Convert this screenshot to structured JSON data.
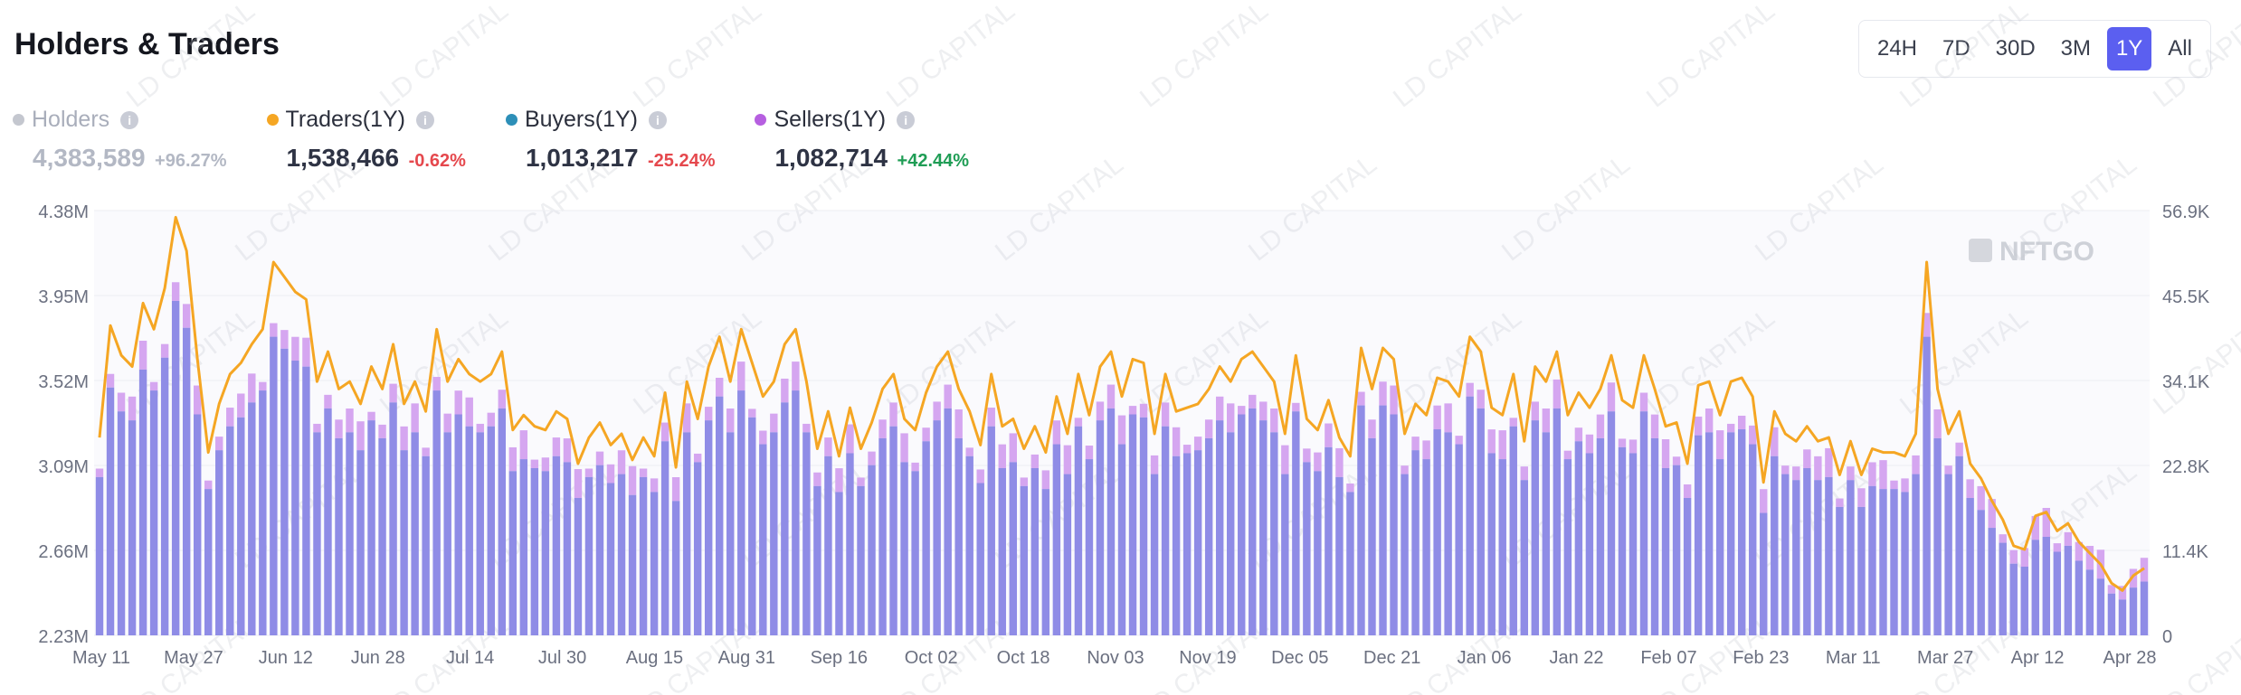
{
  "header": {
    "title": "Holders & Traders"
  },
  "time_range": {
    "options": [
      "24H",
      "7D",
      "30D",
      "3M",
      "1Y",
      "All"
    ],
    "selected": "1Y"
  },
  "legend": [
    {
      "label": "Holders",
      "value": "4,383,589",
      "change": "+96.27%",
      "color": "#c4c7cf",
      "state": "dim"
    },
    {
      "label": "Traders(1Y)",
      "value": "1,538,466",
      "change": "-0.62%",
      "color": "#f5a623",
      "state": "neg"
    },
    {
      "label": "Buyers(1Y)",
      "value": "1,013,217",
      "change": "-25.24%",
      "color": "#2d8fb8",
      "state": "neg"
    },
    {
      "label": "Sellers(1Y)",
      "value": "1,082,714",
      "change": "+42.44%",
      "color": "#b65fe0",
      "state": "pos"
    }
  ],
  "watermarks": {
    "brand": "NFTGO",
    "overlay": "LD CAPITAL"
  },
  "chart_data": {
    "type": "bar",
    "x_labels": [
      "May 11",
      "May 27",
      "Jun 12",
      "Jun 28",
      "Jul 14",
      "Jul 30",
      "Aug 15",
      "Aug 31",
      "Sep 16",
      "Oct 02",
      "Oct 18",
      "Nov 03",
      "Nov 19",
      "Dec 05",
      "Dec 21",
      "Jan 06",
      "Jan 22",
      "Feb 07",
      "Feb 23",
      "Mar 11",
      "Mar 27",
      "Apr 12",
      "Apr 28"
    ],
    "left_axis": {
      "ticks": [
        "2.23M",
        "2.66M",
        "3.09M",
        "3.52M",
        "3.95M",
        "4.38M"
      ],
      "ylim": [
        2.23,
        4.38
      ],
      "unit": "M"
    },
    "right_axis": {
      "ticks": [
        "0",
        "11.4K",
        "22.8K",
        "34.1K",
        "45.5K",
        "56.9K"
      ],
      "ylim": [
        0,
        56.9
      ],
      "unit": "K"
    },
    "grid": true,
    "colors": {
      "traders": "#f5a623",
      "buyers": "#8f8ce6",
      "sellers": "#d5a6f0",
      "grid": "#eceef2"
    },
    "series": [
      {
        "name": "Traders(1Y)",
        "type": "line",
        "axis": "right",
        "unit": "K",
        "values": [
          26.5,
          41.5,
          37.5,
          36.0,
          44.5,
          41.0,
          46.5,
          56.0,
          51.5,
          37.0,
          24.5,
          31.0,
          35.0,
          36.5,
          39.0,
          41.0,
          50.0,
          48.0,
          46.0,
          45.0,
          34.0,
          38.0,
          33.0,
          34.0,
          31.0,
          36.0,
          33.0,
          39.0,
          31.0,
          34.0,
          30.0,
          41.0,
          34.0,
          37.0,
          35.0,
          34.0,
          35.0,
          38.0,
          27.5,
          29.5,
          28.0,
          27.5,
          30.0,
          29.0,
          23.0,
          26.5,
          28.5,
          25.5,
          27.0,
          23.5,
          26.5,
          24.0,
          32.5,
          22.5,
          34.0,
          29.0,
          36.0,
          40.0,
          34.0,
          41.0,
          36.5,
          32.0,
          34.0,
          39.0,
          41.0,
          34.0,
          25.0,
          30.0,
          24.0,
          30.5,
          25.0,
          28.5,
          33.0,
          35.0,
          29.0,
          27.5,
          32.5,
          36.0,
          38.0,
          33.0,
          30.0,
          25.5,
          35.0,
          28.0,
          29.0,
          25.0,
          28.0,
          24.5,
          32.0,
          27.0,
          35.0,
          29.5,
          36.0,
          38.0,
          32.0,
          37.0,
          36.5,
          27.0,
          35.0,
          30.0,
          30.5,
          31.0,
          33.0,
          36.0,
          34.0,
          37.0,
          38.0,
          36.0,
          34.0,
          27.0,
          37.5,
          29.0,
          27.5,
          31.5,
          26.5,
          24.0,
          38.5,
          33.0,
          38.5,
          37.0,
          27.0,
          31.0,
          29.5,
          34.5,
          34.0,
          32.0,
          40.0,
          38.0,
          30.5,
          29.5,
          35.0,
          26.0,
          36.0,
          34.0,
          38.0,
          29.5,
          32.5,
          30.5,
          33.0,
          37.5,
          31.5,
          30.5,
          37.5,
          33.0,
          28.0,
          28.5,
          23.0,
          33.5,
          34.0,
          29.5,
          34.0,
          34.5,
          32.0,
          20.5,
          30.0,
          27.0,
          26.0,
          28.0,
          26.0,
          26.5,
          21.5,
          26.0,
          21.5,
          25.0,
          24.5,
          24.5,
          24.0,
          27.0,
          50.0,
          33.0,
          27.0,
          30.0,
          23.0,
          21.0,
          18.0,
          15.5,
          12.0,
          11.5,
          16.0,
          16.5,
          14.0,
          15.0,
          12.5,
          11.0,
          9.5,
          7.0,
          6.0,
          8.0,
          9.0
        ],
        "start": "May 11"
      },
      {
        "name": "Buyers(1Y)",
        "type": "bar",
        "axis": "left",
        "shape": "daily bars, lower stack"
      },
      {
        "name": "Sellers(1Y)",
        "type": "bar",
        "axis": "left",
        "shape": "daily bars, upper stack"
      }
    ]
  }
}
